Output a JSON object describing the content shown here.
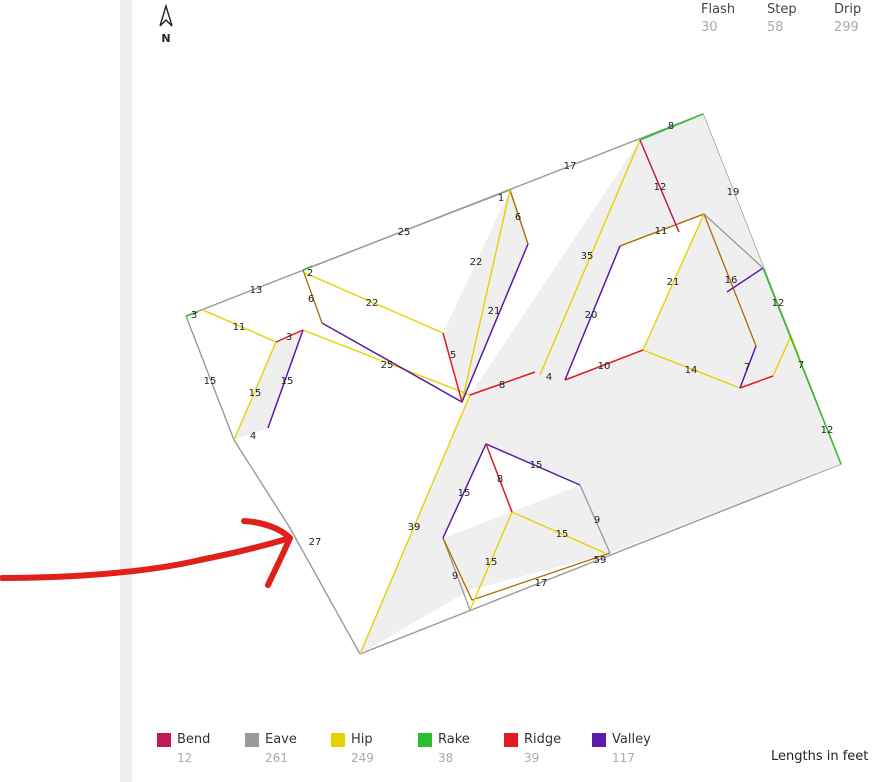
{
  "north": {
    "label": "N"
  },
  "summary": [
    {
      "title": "Flash",
      "value": "30"
    },
    {
      "title": "Step",
      "value": "58"
    },
    {
      "title": "Drip",
      "value": "299"
    }
  ],
  "legend": [
    {
      "name": "Bend",
      "value": "12",
      "color": "#c2185b"
    },
    {
      "name": "Eave",
      "value": "261",
      "color": "#999999"
    },
    {
      "name": "Hip",
      "value": "249",
      "color": "#e6d200"
    },
    {
      "name": "Rake",
      "value": "38",
      "color": "#2ebd2e"
    },
    {
      "name": "Ridge",
      "value": "39",
      "color": "#e01b24"
    },
    {
      "name": "Valley",
      "value": "117",
      "color": "#5b1aa8"
    }
  ],
  "units_note": "Lengths in feet",
  "annotation": {
    "color": "#e0211b"
  },
  "measurements": [
    "8",
    "17",
    "19",
    "12",
    "25",
    "1",
    "6",
    "22",
    "21",
    "5",
    "13",
    "2",
    "6",
    "22",
    "3",
    "11",
    "3",
    "15",
    "15",
    "15",
    "4",
    "25",
    "8",
    "4",
    "35",
    "20",
    "10",
    "11",
    "12",
    "21",
    "16",
    "14",
    "7",
    "7",
    "12",
    "39",
    "27",
    "15",
    "8",
    "15",
    "15",
    "15",
    "9",
    "9",
    "59",
    "17"
  ]
}
